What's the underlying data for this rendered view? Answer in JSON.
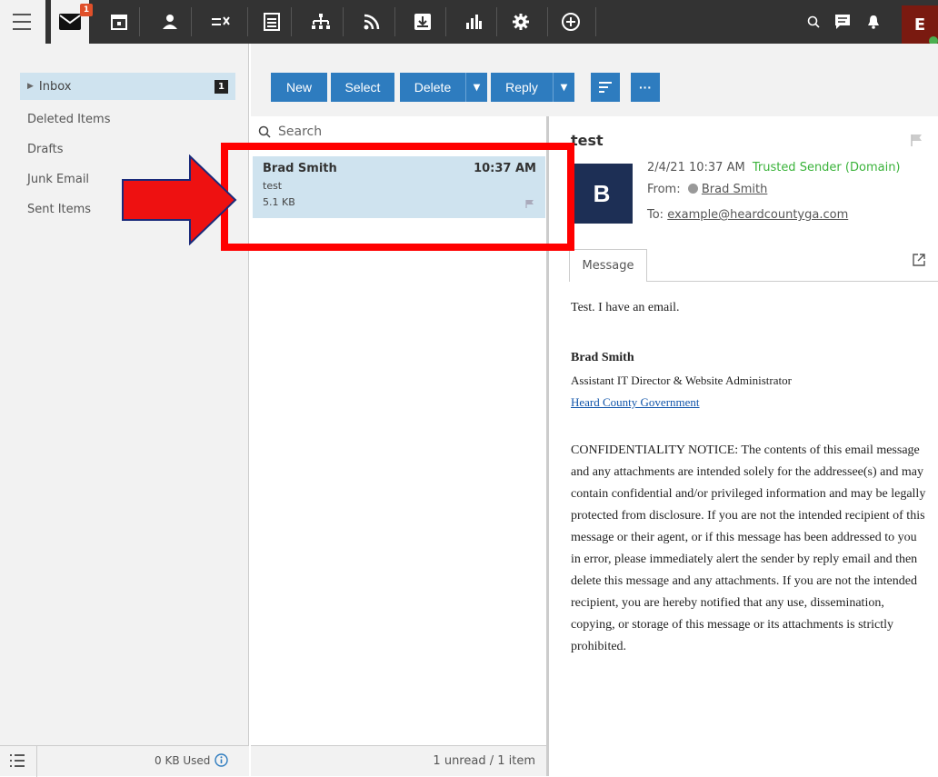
{
  "topbar": {
    "mail_badge": "1",
    "user_initial": "E",
    "icons": [
      "hamburger-icon",
      "mail-icon",
      "calendar-icon",
      "contacts-icon",
      "tasks-icon",
      "notes-icon",
      "sitemap-icon",
      "rss-icon",
      "archive-icon",
      "reports-icon",
      "settings-icon",
      "add-icon",
      "search-icon",
      "chat-icon",
      "bell-icon"
    ]
  },
  "folders": {
    "inbox": {
      "label": "Inbox",
      "count": "1"
    },
    "items": [
      "Deleted Items",
      "Drafts",
      "Junk Email",
      "Sent Items"
    ],
    "storage": "0 KB Used"
  },
  "toolbar": {
    "new": "New",
    "select": "Select",
    "delete": "Delete",
    "reply": "Reply",
    "more": "···"
  },
  "search": {
    "placeholder": "Search"
  },
  "message_list": {
    "messages": [
      {
        "sender": "Brad Smith",
        "time": "10:37 AM",
        "subject": "test",
        "size": "5.1 KB"
      }
    ],
    "status": "1 unread / 1 item"
  },
  "reading": {
    "subject": "test",
    "avatar_initial": "B",
    "date": "2/4/21 10:37 AM",
    "trusted": "Trusted Sender (Domain)",
    "from_label": "From:",
    "from_name": "Brad Smith",
    "to_label": "To:",
    "to_address": "example@heardcountyga.com",
    "tab_label": "Message",
    "body_line": "Test. I have an email.",
    "sig_name": "Brad Smith",
    "sig_title": "Assistant IT Director & Website Administrator",
    "sig_org": "Heard County Government",
    "notice": "CONFIDENTIALITY NOTICE: The contents of this email message and any attachments are intended solely for the addressee(s) and may contain confidential and/or privileged information and may be legally protected from disclosure. If you are not the intended recipient of this message or their agent, or if this message has been addressed to you in error, please immediately alert the sender by reply email and then delete this message and any attachments. If you are not the intended recipient, you are hereby notified that any use, dissemination, copying, or storage of this message or its attachments is strictly prohibited."
  },
  "colors": {
    "accent": "#2e7cbf",
    "selection": "#cfe3ef",
    "trusted": "#3bb33b",
    "annotation": "#ff0000"
  }
}
